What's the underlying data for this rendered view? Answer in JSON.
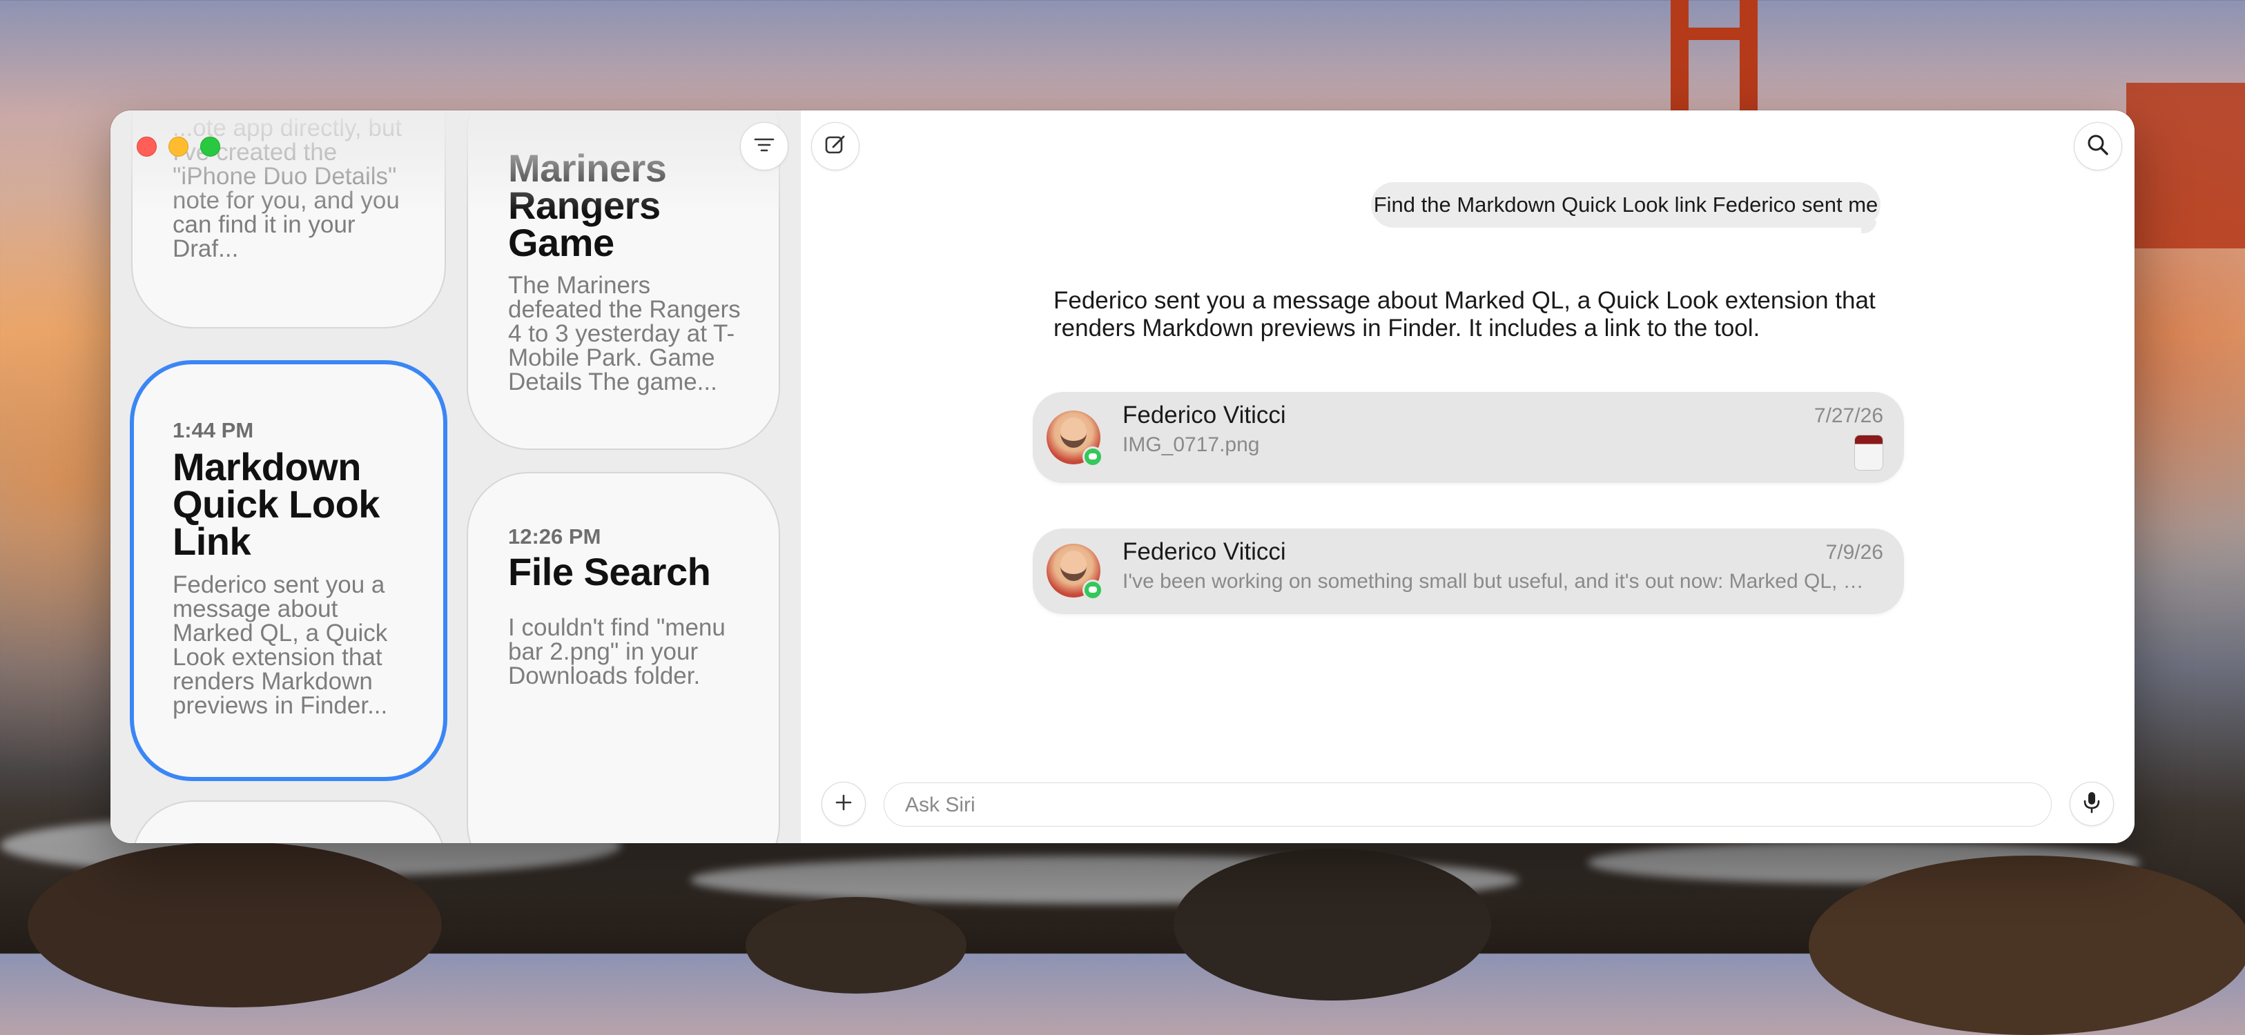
{
  "window": {
    "controls": [
      "close",
      "minimize",
      "maximize"
    ]
  },
  "sidebar": {
    "cards": [
      {
        "time": "",
        "title": "",
        "body": "...ote app directly, but I've created the \"iPhone Duo Details\" note for you, and you can find it in your Draf...",
        "selected": false
      },
      {
        "time": "",
        "title": "Mariners Rangers Game",
        "body": "The Mariners defeated the Rangers 4 to 3 yesterday at T-Mobile Park. Game Details The game...",
        "selected": false
      },
      {
        "time": "1:44 PM",
        "title": "Markdown Quick Look Link",
        "body": "Federico sent you a message about Marked QL, a Quick Look extension that renders Markdown previews in Finder...",
        "selected": true
      },
      {
        "time": "12:26 PM",
        "title": "File Search",
        "body": "I couldn't find \"menu bar 2.png\" in your Downloads folder.",
        "selected": false
      }
    ],
    "filter_icon": "filter-lines-icon"
  },
  "toolbar": {
    "compose_icon": "compose-icon",
    "search_icon": "search-icon"
  },
  "conversation": {
    "user_message": "Find the Markdown Quick Look link Federico sent me",
    "assistant_reply": "Federico sent you a message about Marked QL, a Quick Look extension that renders Markdown previews in Finder. It includes a link to the tool.",
    "results": [
      {
        "sender": "Federico Viticci",
        "preview": "IMG_0717.png",
        "date": "7/27/26",
        "has_thumbnail": true
      },
      {
        "sender": "Federico Viticci",
        "preview": "I've been working on something small but useful, and it's out now: Marked QL, a...",
        "date": "7/9/26",
        "has_thumbnail": false
      }
    ]
  },
  "composer": {
    "placeholder": "Ask Siri",
    "add_icon": "plus-icon",
    "mic_icon": "microphone-icon"
  },
  "colors": {
    "selection_accent": "#3a86f6",
    "messages_badge": "#34c759"
  }
}
